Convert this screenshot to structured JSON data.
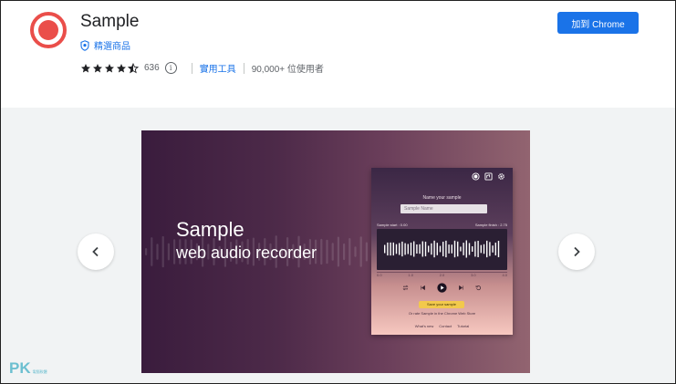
{
  "header": {
    "title": "Sample",
    "featured_label": "精選商品",
    "rating_count": "636",
    "rating_value": 4.5,
    "category": "實用工具",
    "users": "90,000+ 位使用者",
    "install_label": "加到 Chrome"
  },
  "colors": {
    "accent": "#1a73e8",
    "record_red": "#ea4e4a",
    "gallery_bg": "#f1f3f4"
  },
  "gallery": {
    "slide_title": "Sample",
    "slide_subtitle": "web audio recorder",
    "mock": {
      "name_label": "Name your sample",
      "name_placeholder": "Sample Name",
      "left_readout": "Sample start : 0.00",
      "right_readout": "Sample finish : 2.75",
      "timeline": [
        "0.0",
        "1.0",
        "2.0",
        "3.0",
        "4.0"
      ],
      "save_label": "Save your sample",
      "rate_text": "Or rate Sample in the Chrome Web Store",
      "footer": [
        "What's new",
        "Contact",
        "Tutorial"
      ]
    }
  },
  "watermark": {
    "pk": "PK",
    "sub": "電腦軟體"
  }
}
